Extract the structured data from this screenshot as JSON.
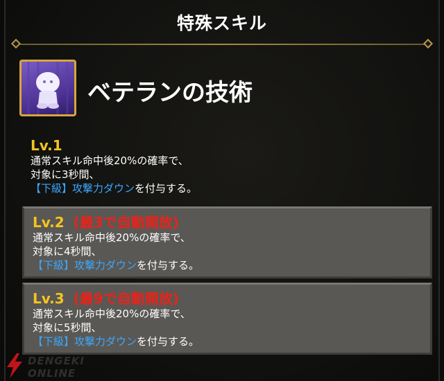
{
  "header": {
    "title": "特殊スキル"
  },
  "skill": {
    "name": "ベテランの技術",
    "icon": "figure-icon"
  },
  "levels": [
    {
      "label": "Lv.1",
      "note": "",
      "line1": "通常スキル命中後20%の確率で、",
      "line2": "対象に3秒間、",
      "debuff": "【下級】攻撃力ダウン",
      "suffix": "を付与する。"
    },
    {
      "label": "Lv.2",
      "note": "(最3で自動開放)",
      "line1": "通常スキル命中後20%の確率で、",
      "line2": "対象に4秒間、",
      "debuff": "【下級】攻撃力ダウン",
      "suffix": "を付与する。"
    },
    {
      "label": "Lv.3",
      "note": "(最9で自動開放)",
      "line1": "通常スキル命中後20%の確率で、",
      "line2": "対象に5秒間、",
      "debuff": "【下級】攻撃力ダウン",
      "suffix": "を付与する。"
    }
  ],
  "watermark": {
    "text": "DENGEKI ONLINE"
  },
  "colors": {
    "level_label": "#f5c320",
    "level_note": "#e8231a",
    "debuff": "#3ba8ff",
    "icon_frame": "#d9a63b"
  }
}
